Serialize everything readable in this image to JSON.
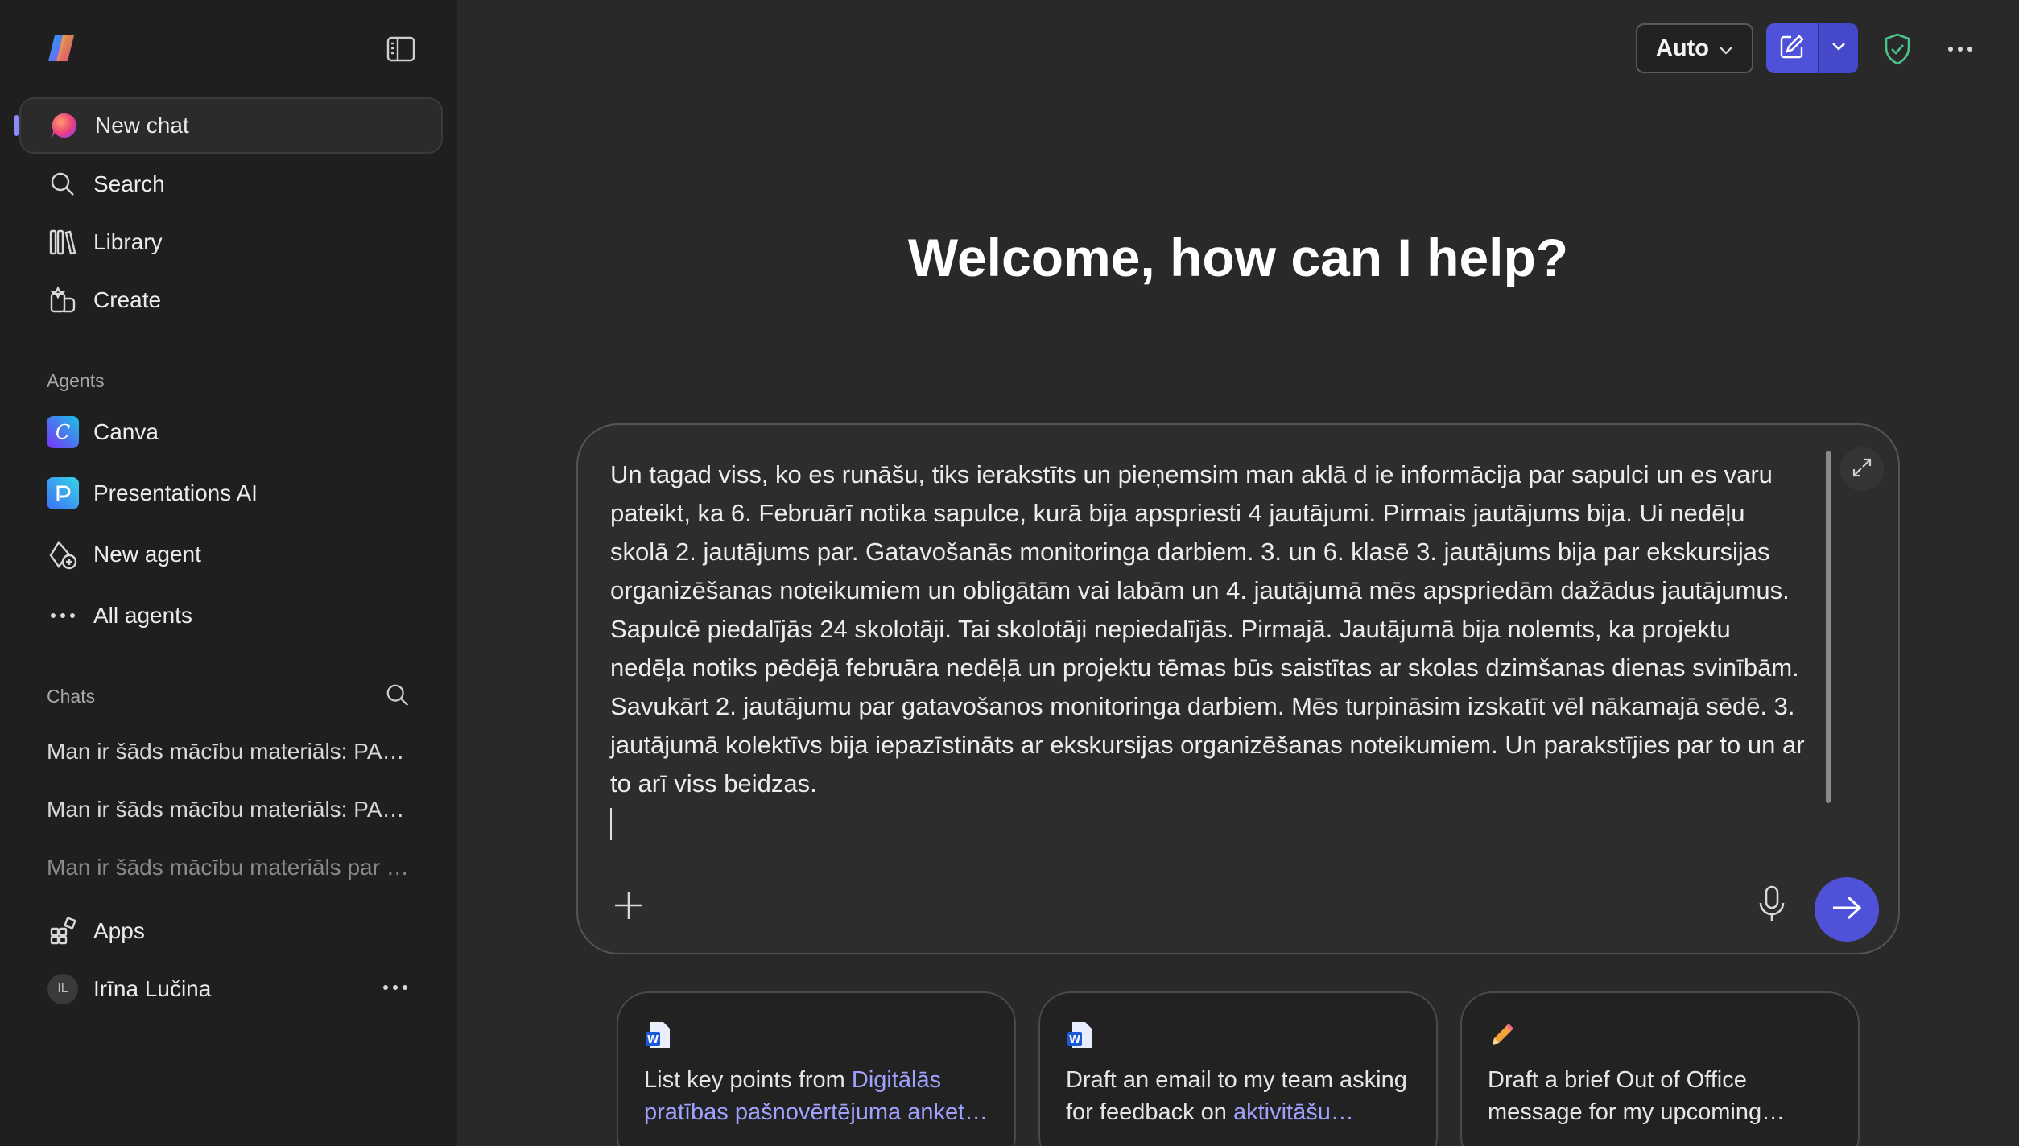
{
  "sidebar": {
    "nav": [
      {
        "label": "New chat",
        "icon": "copilot-orb-icon"
      },
      {
        "label": "Search",
        "icon": "search-icon"
      },
      {
        "label": "Library",
        "icon": "library-icon"
      },
      {
        "label": "Create",
        "icon": "create-icon"
      }
    ],
    "agents_label": "Agents",
    "agents": [
      {
        "label": "Canva",
        "icon": "canva-icon"
      },
      {
        "label": "Presentations AI",
        "icon": "presentations-ai-icon"
      },
      {
        "label": "New agent",
        "icon": "new-agent-icon"
      },
      {
        "label": "All agents",
        "icon": "more-dots-icon"
      }
    ],
    "chats_label": "Chats",
    "chats": [
      "Man ir šāds mācību materiāls: PAMATINFORMĀCIJA",
      "Man ir šāds mācību materiāls: PAMATINFORMĀCIJA",
      "Man ir šāds mācību materiāls par digitālo pratību"
    ],
    "apps_label": "Apps",
    "user": {
      "initials": "IL",
      "name": "Irīna Lučina"
    }
  },
  "topbar": {
    "mode": "Auto"
  },
  "main": {
    "welcome": "Welcome, how can I help?",
    "composer_text": "Un tagad viss, ko es runāšu, tiks ierakstīts un pieņemsim man aklā d ie informācija par sapulci un es varu pateikt, ka 6. Februārī notika sapulce, kurā bija apspriesti 4 jautājumi. Pirmais jautājums bija. Ui nedēļu skolā 2. jautājums par. Gatavošanās monitoringa darbiem. 3. un 6. klasē 3. jautājums bija par ekskursijas organizēšanas noteikumiem un obligātām vai labām un 4. jautājumā mēs apspriedām dažādus jautājumus. Sapulcē piedalījās 24 skolotāji. Tai skolotāji nepiedalījās. Pirmajā. Jautājumā bija nolemts, ka projektu nedēļa notiks pēdējā februāra nedēļā un projektu tēmas būs saistītas ar skolas dzimšanas dienas svinībām. Savukārt 2. jautājumu par gatavošanos monitoringa darbiem. Mēs turpināsim izskatīt vēl nākamajā sēdē. 3. jautājumā kolektīvs bija iepazīstināts ar ekskursijas organizēšanas noteikumiem. Un parakstījies par to un ar to arī viss beidzas."
  },
  "cards": [
    {
      "icon": "word-doc-icon",
      "prefix": "List key points from ",
      "link": "Digitālās pratības pašnovērtējuma anket…"
    },
    {
      "icon": "word-doc-icon",
      "prefix": "Draft an email to my team asking for feedback on ",
      "link": "aktivitāšu…"
    },
    {
      "icon": "pencil-icon",
      "prefix": "Draft a brief Out of Office message for my upcoming…",
      "link": ""
    }
  ],
  "colors": {
    "accent": "#4f52d9",
    "link": "#9fa2ff",
    "sidebar_bg": "#1f1f1f",
    "main_bg": "#292929"
  }
}
